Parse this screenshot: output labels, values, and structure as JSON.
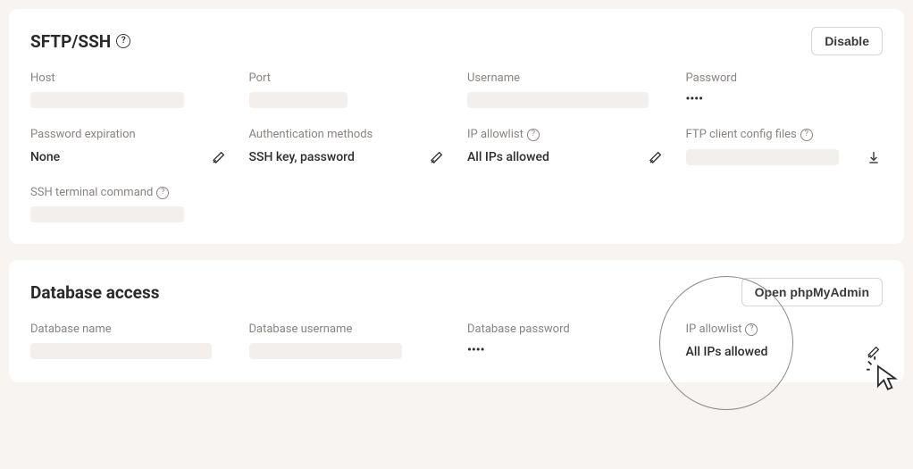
{
  "sftp": {
    "title": "SFTP/SSH",
    "disable_btn": "Disable",
    "host": {
      "label": "Host",
      "value": ""
    },
    "port": {
      "label": "Port",
      "value": ""
    },
    "username": {
      "label": "Username",
      "value": ""
    },
    "password": {
      "label": "Password",
      "value": "••••"
    },
    "password_expiration": {
      "label": "Password expiration",
      "value": "None"
    },
    "auth_methods": {
      "label": "Authentication methods",
      "value": "SSH key, password"
    },
    "ip_allowlist": {
      "label": "IP allowlist",
      "value": "All IPs allowed"
    },
    "ftp_config": {
      "label": "FTP client config files",
      "value": ""
    },
    "ssh_cmd": {
      "label": "SSH terminal command",
      "value": ""
    }
  },
  "db": {
    "title": "Database access",
    "open_btn": "Open phpMyAdmin",
    "name": {
      "label": "Database name",
      "value": ""
    },
    "username": {
      "label": "Database username",
      "value": ""
    },
    "password": {
      "label": "Database password",
      "value": "••••"
    },
    "ip_allowlist": {
      "label": "IP allowlist",
      "value": "All IPs allowed"
    }
  }
}
